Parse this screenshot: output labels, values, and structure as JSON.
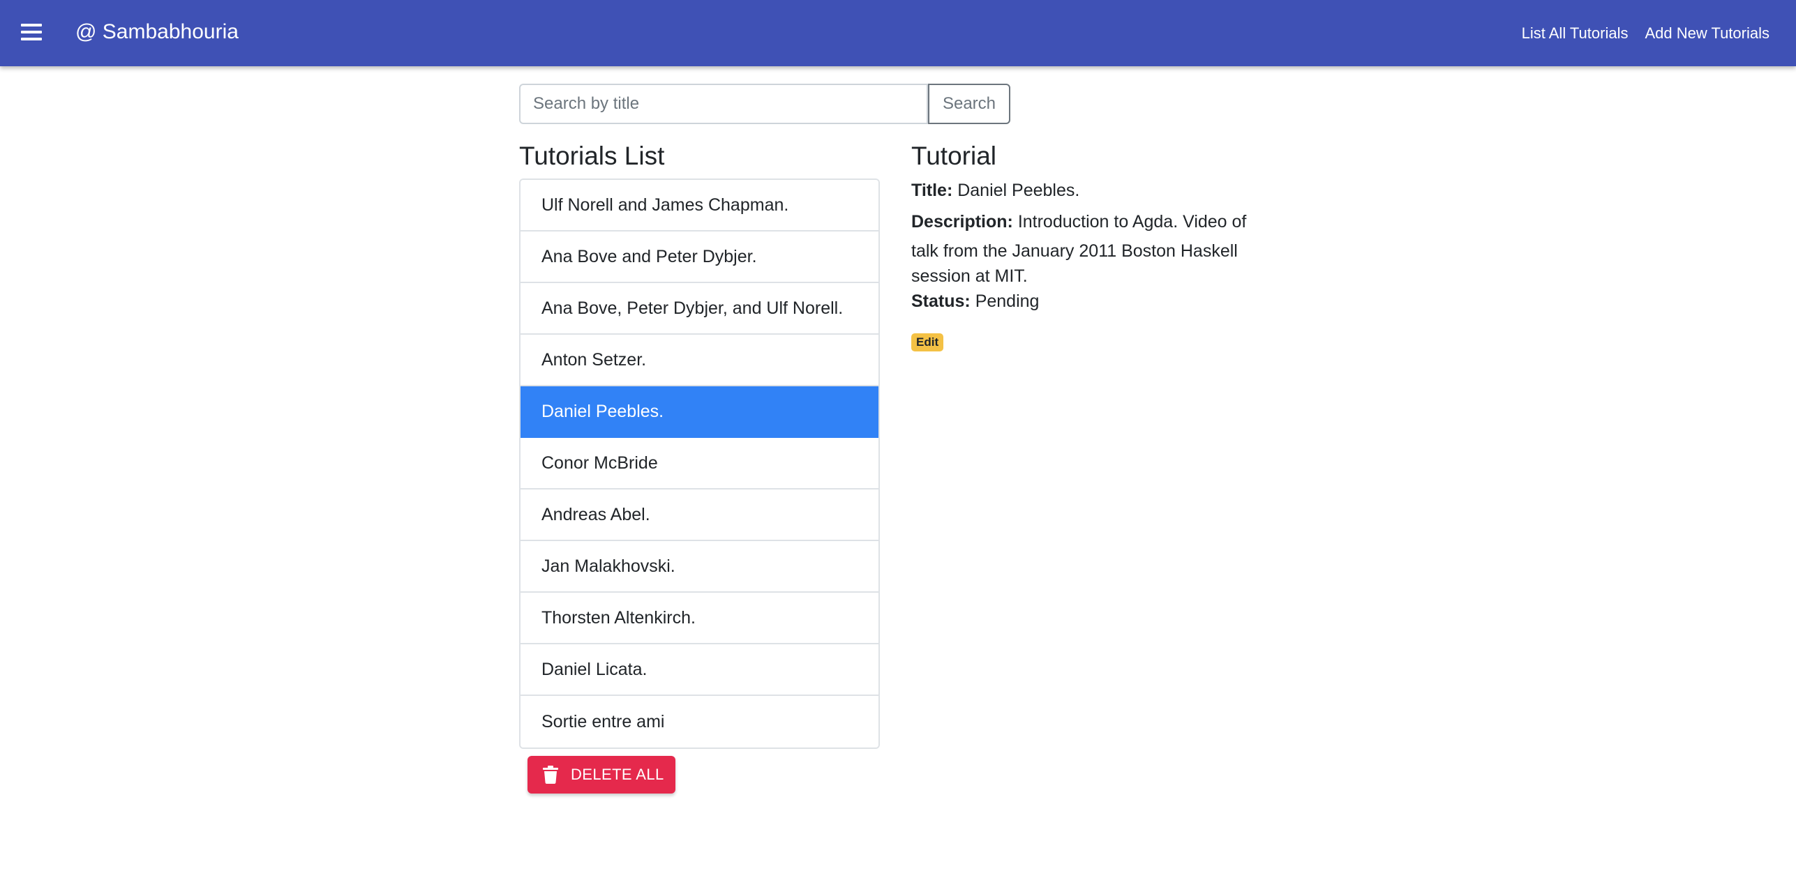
{
  "colors": {
    "brand": "#3f51b5",
    "active_item": "#3182f6",
    "danger": "#e5294c",
    "warning_badge": "#f4c145"
  },
  "appbar": {
    "menu_icon": "hamburger-menu-icon",
    "brand": "@ Sambabhouria",
    "nav": {
      "list_all": "List All Tutorials",
      "add_new": "Add New Tutorials"
    }
  },
  "search": {
    "placeholder": "Search by title",
    "value": "",
    "button_label": "Search"
  },
  "tutorials_list": {
    "heading": "Tutorials List",
    "active_index": 4,
    "items": [
      "Ulf Norell and James Chapman.",
      "Ana Bove and Peter Dybjer.",
      "Ana Bove, Peter Dybjer, and Ulf Norell.",
      "Anton Setzer.",
      "Daniel Peebles.",
      "Conor McBride",
      "Andreas Abel.",
      "Jan Malakhovski.",
      "Thorsten Altenkirch.",
      "Daniel Licata.",
      "Sortie entre ami"
    ],
    "delete_all_label": "DELETE ALL",
    "delete_icon": "trash-icon"
  },
  "tutorial": {
    "heading": "Tutorial",
    "title_label": "Title:",
    "title_value": "Daniel Peebles.",
    "description_label": "Description:",
    "description_line1": "Introduction to Agda. Video of",
    "description_rest": "talk from the January 2011 Boston Haskell session at MIT.",
    "status_label": "Status:",
    "status_value": "Pending",
    "edit_label": "Edit"
  }
}
